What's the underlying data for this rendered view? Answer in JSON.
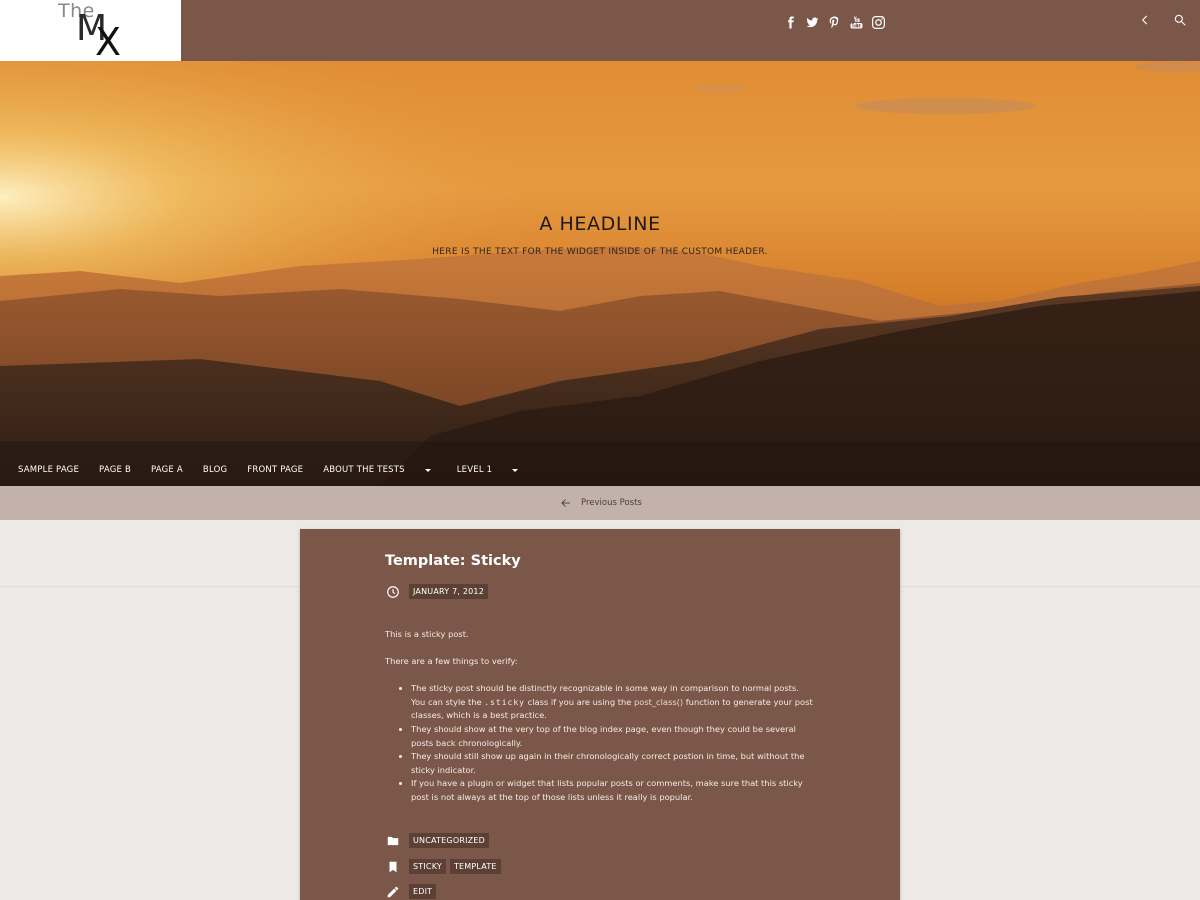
{
  "logo": {
    "the": "The",
    "m": "M",
    "x": "X"
  },
  "social_icons": [
    "facebook-icon",
    "twitter-icon",
    "pinterest-icon",
    "youtube-icon",
    "instagram-icon"
  ],
  "topbar_icons": [
    "chevron-left-icon",
    "search-icon"
  ],
  "hero": {
    "title": "A HEADLINE",
    "subtitle": "HERE IS THE TEXT FOR THE WIDGET INSIDE OF THE CUSTOM HEADER."
  },
  "nav": {
    "items": [
      {
        "label": "SAMPLE PAGE"
      },
      {
        "label": "PAGE B"
      },
      {
        "label": "PAGE A"
      },
      {
        "label": "BLOG"
      },
      {
        "label": "FRONT PAGE"
      },
      {
        "label": "ABOUT THE TESTS"
      },
      {
        "label": "LEVEL 1"
      }
    ]
  },
  "post_nav": {
    "previous_label": "Previous Posts"
  },
  "post": {
    "title": "Template: Sticky",
    "date": "JANUARY 7, 2012",
    "intro": "This is a sticky post.",
    "verify": "There are a few things to verify:",
    "bullets": {
      "b1_a": "The sticky post should be distinctly recognizable in some way in comparison to normal posts. You can style the ",
      "b1_code": ".sticky",
      "b1_b": " class if you are using the ",
      "b1_link": "post_class()",
      "b1_c": " function to generate your post classes, which is a best practice.",
      "b2": "They should show at the very top of the blog index page, even though they could be several posts back chronologically.",
      "b3": "They should still show up again in their chronologically correct postion in time, but without the sticky indicator.",
      "b4": "If you have a plugin or widget that lists popular posts or comments, make sure that this sticky post is not always at the top of those lists unless it really is popular."
    },
    "categories": [
      "UNCATEGORIZED"
    ],
    "tags": [
      "STICKY",
      "TEMPLATE"
    ],
    "edit_label": "EDIT"
  },
  "colors": {
    "topbar": "#7a5748",
    "card": "#7a5748",
    "tag_bg": "#5c4035",
    "post_nav_bg": "#c2b2aa",
    "page_bg": "#ede9e6"
  }
}
